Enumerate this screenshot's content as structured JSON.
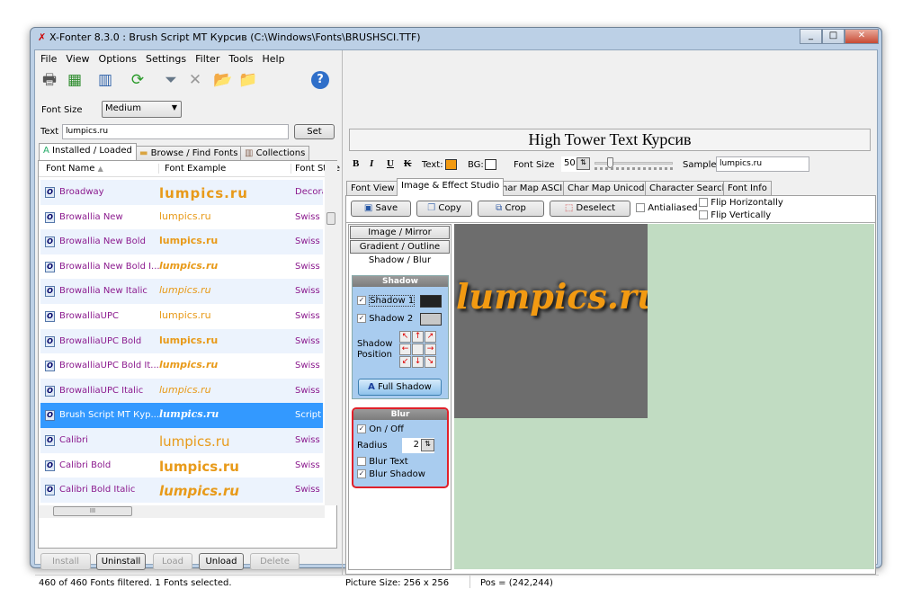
{
  "window": {
    "title": "X-Fonter 8.3.0  :  Brush Script MT Курсив (C:\\Windows\\Fonts\\BRUSHSCI.TTF)",
    "controls": [
      "_",
      "□",
      "✕"
    ]
  },
  "menu": [
    "File",
    "View",
    "Options",
    "Settings",
    "Filter",
    "Tools",
    "Help"
  ],
  "toolbar": [
    {
      "icon": "printer-icon",
      "glyph": "🖶"
    },
    {
      "icon": "table-icon",
      "glyph": "▦"
    },
    {
      "icon": "font-tools-icon",
      "glyph": "▥"
    },
    {
      "icon": "refresh-icon",
      "glyph": "⟳"
    },
    {
      "icon": "filter-icon",
      "glyph": "⏷"
    },
    {
      "icon": "clear-filter-icon",
      "glyph": "✕"
    },
    {
      "icon": "open-folder-icon",
      "glyph": "📂"
    },
    {
      "icon": "export-folder-icon",
      "glyph": "📁"
    },
    {
      "icon": "help-icon",
      "glyph": "?"
    }
  ],
  "left": {
    "font_size_label": "Font Size",
    "font_size_value": "Medium",
    "text_label": "Text",
    "text_value": "lumpics.ru",
    "set_label": "Set",
    "tabs": [
      "Installed / Loaded",
      "Browse / Find Fonts",
      "Collections"
    ],
    "columns": [
      "Font Name",
      "Font Example",
      "Font Style"
    ],
    "rows": [
      {
        "name": "Broadway",
        "example": "lumpics.ru",
        "style": "Decora"
      },
      {
        "name": "Browallia New",
        "example": "lumpics.ru",
        "style": "Swiss ("
      },
      {
        "name": "Browallia New Bold",
        "example": "lumpics.ru",
        "style": "Swiss ("
      },
      {
        "name": "Browallia New Bold I...",
        "example": "lumpics.ru",
        "style": "Swiss ("
      },
      {
        "name": "Browallia New Italic",
        "example": "lumpics.ru",
        "style": "Swiss ("
      },
      {
        "name": "BrowalliaUPC",
        "example": "lumpics.ru",
        "style": "Swiss ("
      },
      {
        "name": "BrowalliaUPC Bold",
        "example": "lumpics.ru",
        "style": "Swiss ("
      },
      {
        "name": "BrowalliaUPC Bold It...",
        "example": "lumpics.ru",
        "style": "Swiss ("
      },
      {
        "name": "BrowalliaUPC Italic",
        "example": "lumpics.ru",
        "style": "Swiss ("
      },
      {
        "name": "Brush Script MT Кур...",
        "example": "lumpics.ru",
        "style": "Script ("
      },
      {
        "name": "Calibri",
        "example": "lumpics.ru",
        "style": "Swiss ("
      },
      {
        "name": "Calibri Bold",
        "example": "lumpics.ru",
        "style": "Swiss ("
      },
      {
        "name": "Calibri Bold Italic",
        "example": "lumpics.ru",
        "style": "Swiss ("
      }
    ],
    "selected_index": 9,
    "buttons": [
      "Install",
      "Uninstall",
      "Load",
      "Unload",
      "Delete"
    ],
    "status": "460 of 460 Fonts filtered.   1 Fonts selected."
  },
  "right": {
    "preview_title": "High Tower Text Курсив",
    "format": {
      "bold": "B",
      "italic": "I",
      "underline": "U",
      "strike": "K",
      "text_label": "Text:",
      "text_color": "#f29a12",
      "bg_label": "BG:",
      "bg_color": "#ffffff",
      "font_size_label": "Font Size",
      "font_size_value": "50",
      "sample_label": "Sample",
      "sample_value": "lumpics.ru"
    },
    "tabs": [
      "Font View",
      "Image & Effect Studio",
      "Char Map ASCII",
      "Char Map Unicode",
      "Character Search",
      "Font Info"
    ],
    "active_tab": 1,
    "studio": {
      "save": "Save",
      "copy": "Copy",
      "crop": "Crop",
      "deselect": "Deselect",
      "antialiased": "Antialiased",
      "flip_h": "Flip Horizontally",
      "flip_v": "Flip Vertically"
    },
    "side_tabs": [
      "Image / Mirror",
      "Gradient / Outline",
      "Shadow / Blur"
    ],
    "shadow": {
      "title": "Shadow",
      "shadow1": "Shadow 1",
      "shadow2": "Shadow 2",
      "position_label": "Shadow Position",
      "full_shadow": "Full Shadow",
      "shadow1_color": "#222222",
      "shadow2_color": "#c8c8c8"
    },
    "blur": {
      "title": "Blur",
      "on_off": "On / Off",
      "radius_label": "Radius",
      "radius_value": "2",
      "blur_text": "Blur Text",
      "blur_shadow": "Blur Shadow"
    },
    "canvas_text": "lumpics.ru",
    "status_size": "Picture Size: 256 x 256",
    "status_pos": "Pos = (242,244)"
  }
}
